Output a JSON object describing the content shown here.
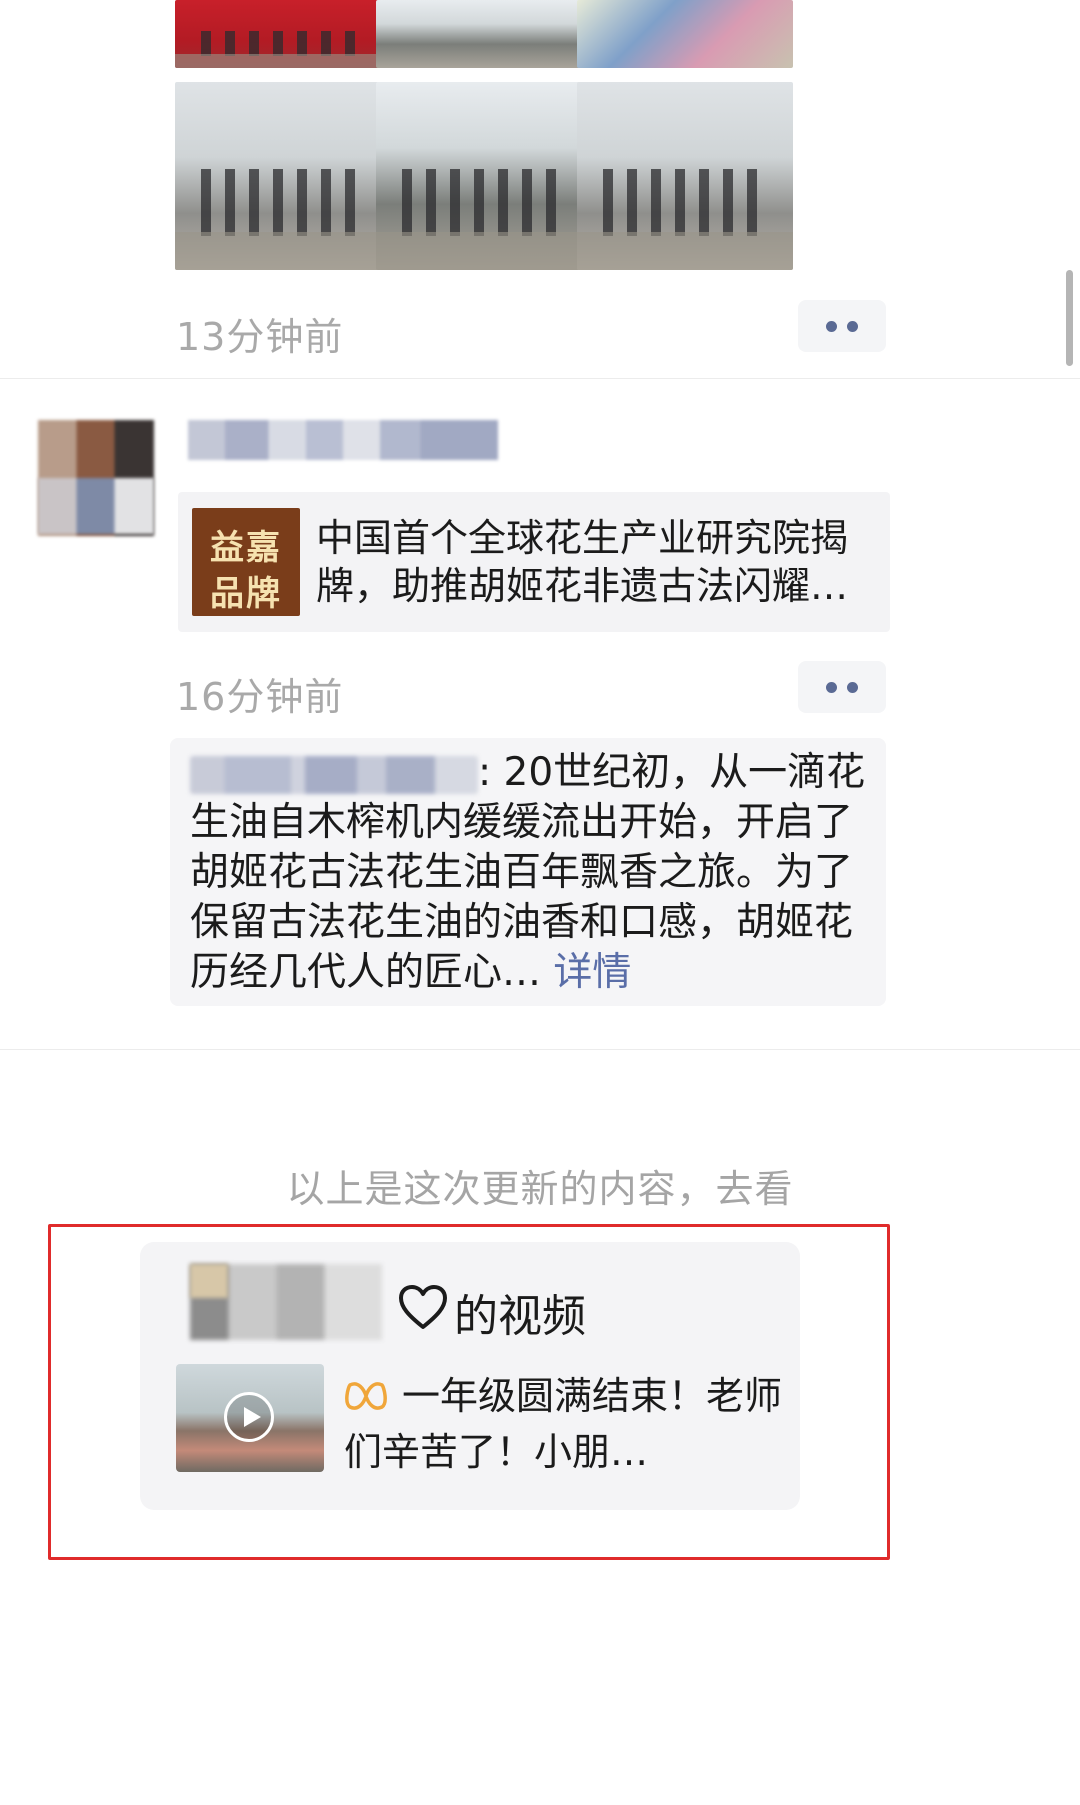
{
  "post1": {
    "time": "13分钟前"
  },
  "post2": {
    "share_thumb_line1": "益嘉",
    "share_thumb_line2": "品牌",
    "share_title": "中国首个全球花生产业研究院揭牌，助推胡姬花非遗古法闪耀…",
    "time": "16分钟前",
    "comment": ": 20世纪初，从一滴花生油自木榨机内缓缓流出开始，开启了胡姬花古法花生油百年飘香之旅。为了保留古法花生油的油香和口感，胡姬花历经几代人的匠心…",
    "detail_link": "详情"
  },
  "update_note": "以上是这次更新的内容，去看",
  "video_card": {
    "label": "的视频",
    "desc": "一年级圆满结束！老师们辛苦了！小朋…"
  },
  "colors": {
    "link": "#5a6ea8",
    "highlight_frame": "#e02b2b",
    "timestamp": "#a9a9a9"
  },
  "icons": [
    "more-dots-icon",
    "heart-icon",
    "play-icon",
    "loop-icon"
  ]
}
